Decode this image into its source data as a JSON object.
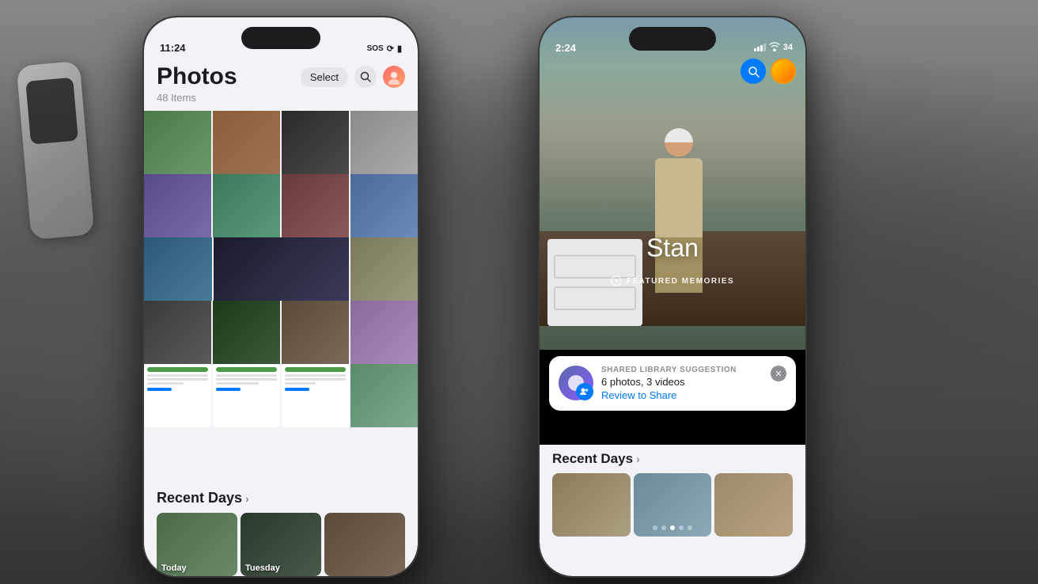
{
  "scene": {
    "bg_description": "Two iPhones held in hands against dark background"
  },
  "left_phone": {
    "status_bar": {
      "time": "11:24",
      "indicators": "SOS · WiFi · Battery"
    },
    "header": {
      "title": "Photos",
      "subtitle": "48 Items",
      "select_button": "Select"
    },
    "grid": {
      "description": "Photo mosaic grid with various photos"
    },
    "recent_days": {
      "label": "Recent Days",
      "chevron": "›",
      "days": [
        {
          "label": "Today"
        },
        {
          "label": "Tuesday"
        },
        {
          "label": ""
        }
      ]
    }
  },
  "right_phone": {
    "status_bar": {
      "time": "2:24",
      "battery": "34"
    },
    "person": {
      "name": "Stan",
      "badge": "FEATURED MEMORIES"
    },
    "suggestion": {
      "label": "SHARED LIBRARY SUGGESTION",
      "description": "6 photos, 3 videos",
      "link": "Review to Share"
    },
    "recent_days": {
      "label": "Recent Days",
      "chevron": "›"
    }
  }
}
